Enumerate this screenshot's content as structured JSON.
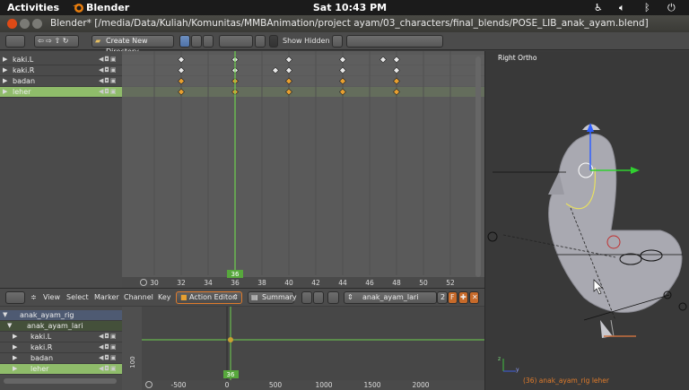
{
  "system_bar": {
    "activities": "Activities",
    "app_name": "Blender",
    "clock": "Sat 10:43 PM"
  },
  "window": {
    "title": "Blender* [/media/Data/Kuliah/Komunitas/MMBAnimation/project ayam/03_characters/final_blends/POSE_LIB_anak_ayam.blend]"
  },
  "file_header": {
    "create_dir_label": "Create New Directory",
    "show_hidden_label": "Show Hidden"
  },
  "dopesheet": {
    "channels": [
      {
        "name": "kaki.L",
        "selected": false
      },
      {
        "name": "kaki.R",
        "selected": false
      },
      {
        "name": "badan",
        "selected": false
      },
      {
        "name": "leher",
        "selected": true
      }
    ],
    "frame_ticks": [
      "30",
      "32",
      "34",
      "36",
      "38",
      "40",
      "42",
      "44",
      "46",
      "48",
      "50",
      "52"
    ],
    "current_frame": "36",
    "keys": {
      "row0": [
        32,
        36,
        40,
        44,
        47,
        48
      ],
      "row1": [
        32,
        36,
        39,
        40,
        44,
        48
      ],
      "row2": [
        32,
        36,
        40,
        44,
        48
      ],
      "row3": [
        32,
        36,
        40,
        44,
        48
      ]
    },
    "menus": [
      "View",
      "Select",
      "Marker",
      "Channel",
      "Key"
    ],
    "mode_label": "Action Editor",
    "summary_label": "Summary",
    "action_name": "anak_ayam_lari",
    "users_count": "2",
    "fake_user": "F"
  },
  "graph_editor": {
    "channels": [
      {
        "name": "anak_ayam_rig",
        "level": 0
      },
      {
        "name": "anak_ayam_lari",
        "level": 1
      },
      {
        "name": "kaki.L",
        "level": 2
      },
      {
        "name": "kaki.R",
        "level": 2
      },
      {
        "name": "badan",
        "level": 2
      },
      {
        "name": "leher",
        "level": 2
      }
    ],
    "x_ticks": [
      "-500",
      "0",
      "500",
      "1000",
      "1500",
      "2000"
    ],
    "y_tick": "100",
    "current_frame": "36"
  },
  "viewport": {
    "view_label": "Right Ortho",
    "status": "(36) anak_ayam_rig leher"
  },
  "colors": {
    "selected_channel": "#8fbc6a",
    "keyframe_selected": "#e8a030",
    "playhead": "#6fd04f",
    "accent_orange": "#e07b2b"
  }
}
